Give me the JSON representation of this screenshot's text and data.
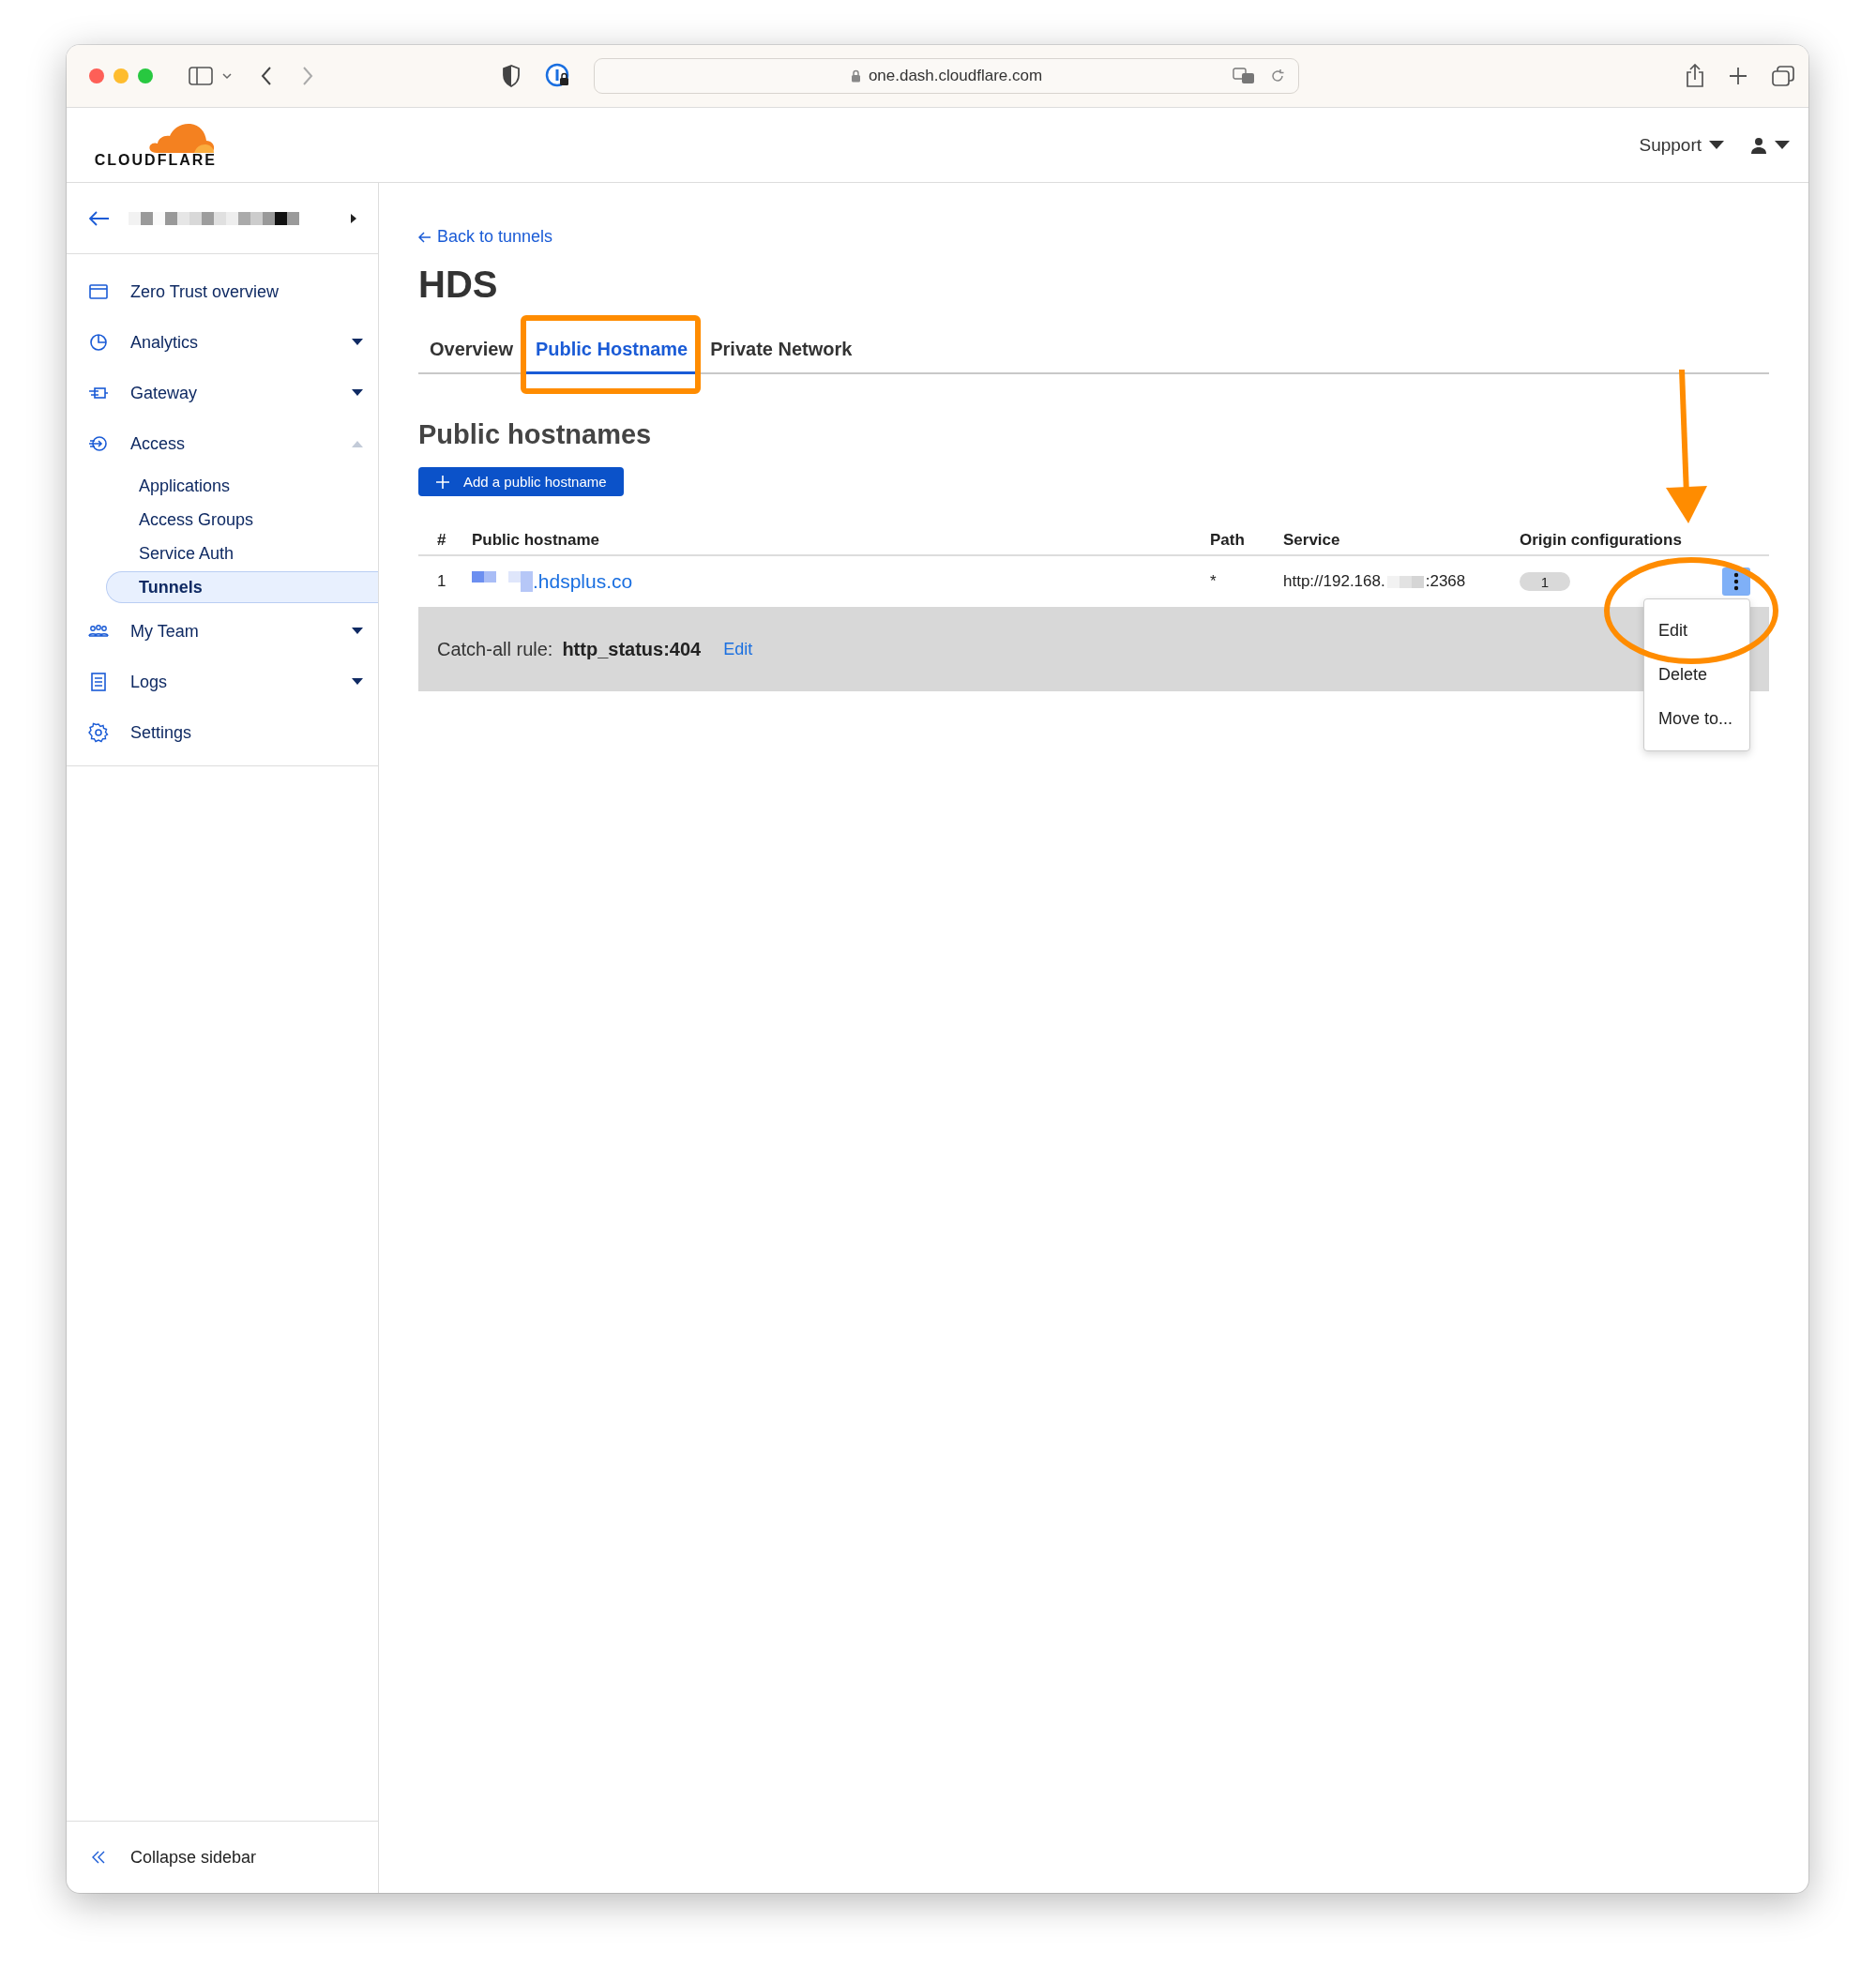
{
  "browser": {
    "url": "one.dash.cloudflare.com"
  },
  "header": {
    "logo": "CLOUDFLARE",
    "support_menu": "Support"
  },
  "sidebar": {
    "items": [
      {
        "label": "Zero Trust overview",
        "kind": "link"
      },
      {
        "label": "Analytics",
        "kind": "group",
        "expanded": false
      },
      {
        "label": "Gateway",
        "kind": "group",
        "expanded": false
      },
      {
        "label": "Access",
        "kind": "group",
        "expanded": true,
        "children": [
          {
            "label": "Applications",
            "selected": false
          },
          {
            "label": "Access Groups",
            "selected": false
          },
          {
            "label": "Service Auth",
            "selected": false
          },
          {
            "label": "Tunnels",
            "selected": true
          }
        ]
      },
      {
        "label": "My Team",
        "kind": "group",
        "expanded": false
      },
      {
        "label": "Logs",
        "kind": "group",
        "expanded": false
      },
      {
        "label": "Settings",
        "kind": "link"
      }
    ],
    "collapse": "Collapse sidebar"
  },
  "main": {
    "back_link": "Back to tunnels",
    "title": "HDS",
    "tabs": [
      {
        "label": "Overview",
        "selected": false
      },
      {
        "label": "Public Hostname",
        "selected": true
      },
      {
        "label": "Private Network",
        "selected": false
      }
    ],
    "section_title": "Public hostnames",
    "add_button": "Add a public hostname",
    "table": {
      "columns": [
        "#",
        "Public hostname",
        "Path",
        "Service",
        "Origin configurations"
      ],
      "rows": [
        {
          "number": "1",
          "hostname": ".hdsplus.co",
          "path": "*",
          "service_start": "http://192.168.",
          "service_end": ":2368",
          "origin_configurations": "1"
        }
      ]
    },
    "catch_all": {
      "label": "Catch-all rule:",
      "value": "http_status:404",
      "edit": "Edit"
    },
    "row_menu": {
      "items": [
        "Edit",
        "Delete",
        "Move to..."
      ]
    }
  }
}
